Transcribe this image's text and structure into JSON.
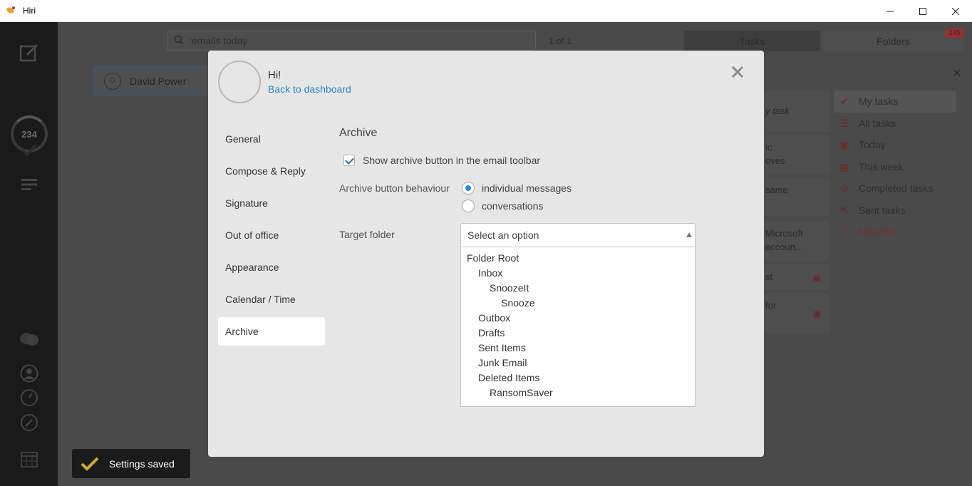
{
  "window": {
    "title": "Hiri",
    "minimize_glyph": "—",
    "maximize_glyph": "☐",
    "close_glyph": "✕"
  },
  "background": {
    "rail_count": "234",
    "search_value": ":emails today",
    "pager": "1 of 1",
    "tab_tasks": "Tasks",
    "tab_folders": "Folders",
    "folders_badge": "245",
    "contact_initial": "D",
    "contact_name": "David Power",
    "task_cards": [
      {
        "text": "y task"
      },
      {
        "text": "ic\noves"
      },
      {
        "text": "same\n"
      },
      {
        "text": "Microsoft\naccoun..."
      },
      {
        "text": "st"
      },
      {
        "text": "for"
      }
    ],
    "task_lists": [
      {
        "label": "My tasks",
        "icon": "check-icon"
      },
      {
        "label": "All tasks",
        "icon": "list-icon"
      },
      {
        "label": "Today",
        "icon": "calendar-check-icon"
      },
      {
        "label": "This week",
        "icon": "calendar-grid-icon"
      },
      {
        "label": "Completed tasks",
        "icon": "circle-check-icon"
      },
      {
        "label": "Sent tasks",
        "icon": "share-icon"
      },
      {
        "label": "New list",
        "icon": "plus-icon"
      }
    ]
  },
  "toast": {
    "text": "Settings saved",
    "check_color": "#c9b02e"
  },
  "modal": {
    "greeting": "Hi!",
    "back_link": "Back to dashboard",
    "nav": [
      {
        "label": "General"
      },
      {
        "label": "Compose & Reply"
      },
      {
        "label": "Signature"
      },
      {
        "label": "Out of office"
      },
      {
        "label": "Appearance"
      },
      {
        "label": "Calendar / Time"
      },
      {
        "label": "Archive",
        "active": true
      }
    ],
    "section_title": "Archive",
    "show_archive_label": "Show archive button in the email toolbar",
    "show_archive_checked": true,
    "behaviour_label": "Archive button behaviour",
    "behaviour_options": [
      {
        "label": "individual messages",
        "checked": true
      },
      {
        "label": "conversations",
        "checked": false
      }
    ],
    "target_label": "Target folder",
    "target_placeholder": "Select an option",
    "folders": [
      {
        "label": "Folder Root",
        "level": 0
      },
      {
        "label": "Inbox",
        "level": 1
      },
      {
        "label": "SnoozeIt",
        "level": 2
      },
      {
        "label": "Snooze",
        "level": 3
      },
      {
        "label": "Outbox",
        "level": 1
      },
      {
        "label": "Drafts",
        "level": 1
      },
      {
        "label": "Sent Items",
        "level": 1
      },
      {
        "label": "Junk Email",
        "level": 1
      },
      {
        "label": "Deleted Items",
        "level": 1
      },
      {
        "label": "RansomSaver",
        "level": 2
      }
    ]
  },
  "colors": {
    "accent": "#2a84c6",
    "modal_bg": "#e6e6e6",
    "overlay": "#4a4a4a"
  }
}
